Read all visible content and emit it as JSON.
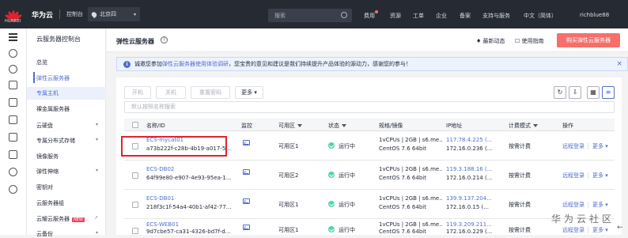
{
  "topbar": {
    "logo_text": "HUAWEI",
    "brand": "华为云",
    "console": "控制台",
    "region": "北京四",
    "search_placeholder": "搜索",
    "nav": [
      "费用",
      "资源",
      "工单",
      "企业",
      "备案",
      "支持与服务",
      "中文（简体）",
      "richblue88"
    ]
  },
  "sidebar": {
    "title": "云服务器控制台",
    "items": [
      {
        "label": "总览"
      },
      {
        "label": "弹性云服务器"
      },
      {
        "label": "专属主机"
      },
      {
        "label": "裸金属服务器"
      },
      {
        "label": "云硬盘"
      },
      {
        "label": "专属分布式存储"
      },
      {
        "label": "镜像服务"
      },
      {
        "label": "弹性伸缩"
      },
      {
        "label": "密钥对"
      },
      {
        "label": "云服务器组"
      },
      {
        "label": "云耀云服务器",
        "badge": "NEW"
      },
      {
        "label": "云备份"
      }
    ]
  },
  "header": {
    "title": "弹性云服务器",
    "help": "?",
    "latest_news": "最新动态",
    "guide": "使用指南",
    "buy_button": "购买弹性云服务器"
  },
  "notice": {
    "prefix": "诚邀您参加",
    "link": "弹性云服务器使用体验调研",
    "suffix": "，您宝贵的意见和建议是我们持续提升产品体验的源动力，感谢您的参与！",
    "close": "×"
  },
  "toolbar": {
    "start": "开机",
    "stop": "关机",
    "reset_password": "重置密码",
    "more": "更多"
  },
  "filter": {
    "placeholder": "默认按照名称搜索"
  },
  "table": {
    "columns": [
      "名称/ID",
      "监控",
      "可用区",
      "状态",
      "规格/镜像",
      "IP地址",
      "计费模式",
      "操作"
    ],
    "rows": [
      {
        "name": "ECS-mycat01",
        "id": "a73b222f-c28b-4b19-a017-5...",
        "az": "可用区1",
        "status": "运行中",
        "spec1": "1vCPUs | 2GB | s6.me...",
        "spec2": "CentOS 7.6 64bit",
        "ip1": "117.78.4.225 (...",
        "ip2": "172.16.0.236 (...",
        "billing": "按需计费",
        "op1": "远程登录",
        "op2": "更多"
      },
      {
        "name": "ECS-DB02",
        "id": "64f99e80-e907-4e93-95ea-1...",
        "az": "可用区2",
        "status": "运行中",
        "spec1": "1vCPUs | 2GB | s6.me...",
        "spec2": "CentOS 7.6 64bit",
        "ip1": "119.3.188.16 (...",
        "ip2": "172.16.0.214 (...",
        "billing": "按需计费",
        "op1": "远程登录",
        "op2": "更多"
      },
      {
        "name": "ECS-DB01",
        "id": "218f3c1f-54a4-40b1-af42-77...",
        "az": "可用区1",
        "status": "运行中",
        "spec1": "1vCPUs | 2GB | s6.me...",
        "spec2": "CentOS 7.6 64bit",
        "ip1": "139.9.137.204...",
        "ip2": "172.16.0.15 (...",
        "billing": "按需计费",
        "op1": "远程登录",
        "op2": "更多"
      },
      {
        "name": "ECS-WEB01",
        "id": "9d7cbe57-ca31-4326-bd7f-d...",
        "az": "可用区1",
        "status": "运行中",
        "spec1": "1vCPUs | 2GB | s6.me...",
        "spec2": "CentOS 7.6 64bit",
        "ip1": "119.3.209.211...",
        "ip2": "172.16.0.229 (...",
        "billing": "按需计费",
        "op1": "远程登录",
        "op2": "更多"
      }
    ]
  },
  "watermark": "华为云社区",
  "colors": {
    "topbar": "#262b33",
    "accent": "#526ecc",
    "buy": "#f66f6a",
    "running": "#50d4ab",
    "highlight": "#e3212e"
  }
}
